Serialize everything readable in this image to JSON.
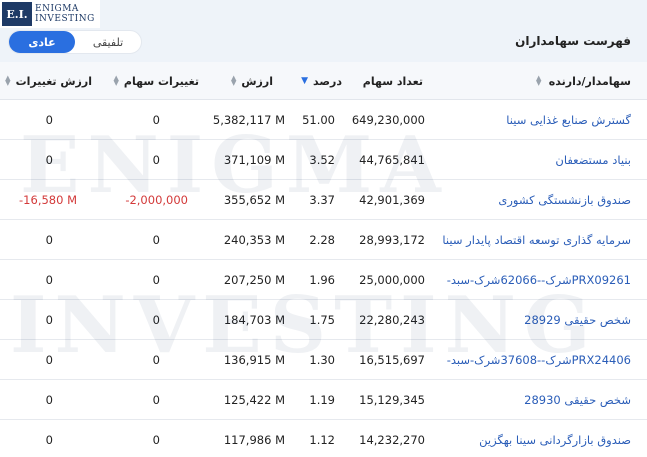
{
  "logo": {
    "mark": "E.I.",
    "line1": "ENIGMA",
    "line2": "INVESTING"
  },
  "watermark": {
    "line1": "ENIGMA",
    "line2": "INVESTING"
  },
  "panel": {
    "title": "فهرست سهامداران",
    "toggle": {
      "active_label": "عادی",
      "inactive_label": "تلفیقی"
    }
  },
  "columns": {
    "holder": "سهامدار/دارنده",
    "shares": "تعداد سهام",
    "percent": "درصد",
    "value": "ارزش",
    "share_change": "تغییرات سهام",
    "value_change": "ارزش تغییرات"
  },
  "rows": [
    {
      "holder": "گسترش صنایع غذایی سینا",
      "shares": "649,230,000",
      "percent": "51.00",
      "value": "5,382,117 M",
      "share_change": "0",
      "value_change": "0",
      "negative": false
    },
    {
      "holder": "بنیاد مستضعفان",
      "shares": "44,765,841",
      "percent": "3.52",
      "value": "371,109 M",
      "share_change": "0",
      "value_change": "0",
      "negative": false
    },
    {
      "holder": "صندوق بازنشستگی کشوری",
      "shares": "42,901,369",
      "percent": "3.37",
      "value": "355,652 M",
      "share_change": "-2,000,000",
      "value_change": "-16,580 M",
      "negative": true
    },
    {
      "holder": "سرمایه گذاری توسعه اقتصاد پایدار سینا",
      "shares": "28,993,172",
      "percent": "2.28",
      "value": "240,353 M",
      "share_change": "0",
      "value_change": "0",
      "negative": false
    },
    {
      "holder": "PRX09261شرک--62066شرک-سبد-",
      "shares": "25,000,000",
      "percent": "1.96",
      "value": "207,250 M",
      "share_change": "0",
      "value_change": "0",
      "negative": false
    },
    {
      "holder": "شخص حقیقی 28929",
      "shares": "22,280,243",
      "percent": "1.75",
      "value": "184,703 M",
      "share_change": "0",
      "value_change": "0",
      "negative": false
    },
    {
      "holder": "PRX24406شرک--37608شرک-سبد-",
      "shares": "16,515,697",
      "percent": "1.30",
      "value": "136,915 M",
      "share_change": "0",
      "value_change": "0",
      "negative": false
    },
    {
      "holder": "شخص حقیقی 28930",
      "shares": "15,129,345",
      "percent": "1.19",
      "value": "125,422 M",
      "share_change": "0",
      "value_change": "0",
      "negative": false
    },
    {
      "holder": "صندوق بازارگردانی سینا بهگزین",
      "shares": "14,232,270",
      "percent": "1.12",
      "value": "117,986 M",
      "share_change": "0",
      "value_change": "0",
      "negative": false
    }
  ],
  "colors": {
    "accent": "#2a6fe0",
    "link": "#2a5db8",
    "negative": "#d33a3a",
    "header_bg": "#eef3f9"
  }
}
